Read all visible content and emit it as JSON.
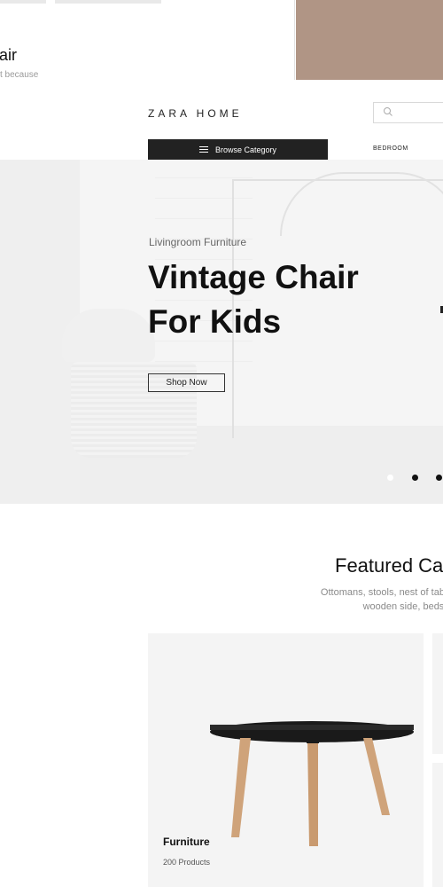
{
  "top_strip": {
    "title_fragment": "air",
    "snippet_fragment": "t because",
    "swatch_color": "#b09585"
  },
  "header": {
    "logo": "ZARA HOME",
    "search_placeholder": "",
    "browse_label": "Browse Category",
    "nav_items": [
      "BEDROOM"
    ]
  },
  "hero": {
    "kicker": "Livingroom Furniture",
    "headline_line1": "Vintage Chair",
    "headline_line2": "For Kids",
    "cta_label": "Shop Now",
    "slides_active_index": 0,
    "slide_dot_count": 3
  },
  "featured": {
    "title_fragment": "Featured Ca",
    "description_line1": "Ottomans, stools, nest of tables",
    "description_line2": "wooden side, bedside"
  },
  "cards": [
    {
      "title": "Furniture",
      "count": "200 Products"
    }
  ],
  "colors": {
    "accent_dark": "#222222",
    "background": "#ffffff",
    "hero_background": "#f3f3f3"
  },
  "icons": [
    "search-icon",
    "menu-icon",
    "table-image"
  ]
}
